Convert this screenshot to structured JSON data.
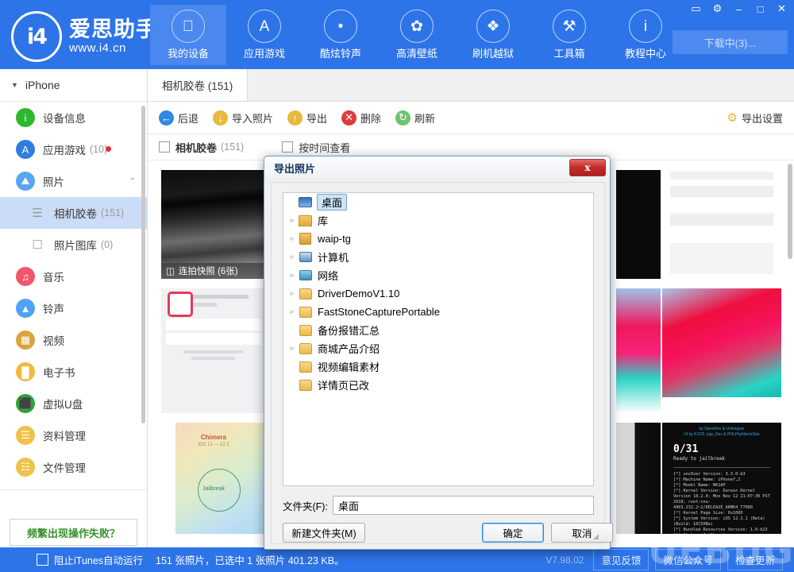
{
  "app": {
    "brand_cn": "爱思助手",
    "brand_url": "www.i4.cn",
    "logo_text": "i4",
    "accent": "#2d74e8",
    "accent_active": "#4a87ee"
  },
  "topnav": {
    "items": [
      {
        "label": "我的设备",
        "icon": "apple-icon",
        "glyph": "",
        "active": true
      },
      {
        "label": "应用游戏",
        "icon": "appstore-icon",
        "glyph": "A",
        "active": false
      },
      {
        "label": "酷炫铃声",
        "icon": "bell-icon",
        "glyph": "•",
        "active": false
      },
      {
        "label": "高清壁纸",
        "icon": "flower-icon",
        "glyph": "✿",
        "active": false
      },
      {
        "label": "刷机越狱",
        "icon": "box-icon",
        "glyph": "❖",
        "active": false
      },
      {
        "label": "工具箱",
        "icon": "tools-icon",
        "glyph": "⚒",
        "active": false
      },
      {
        "label": "教程中心",
        "icon": "info-icon",
        "glyph": "i",
        "active": false
      }
    ],
    "window_buttons": [
      {
        "name": "skin-icon",
        "glyph": "▭"
      },
      {
        "name": "settings-gear-icon",
        "glyph": "⚙"
      },
      {
        "name": "minimize-icon",
        "glyph": "–"
      },
      {
        "name": "maximize-icon",
        "glyph": "□"
      },
      {
        "name": "close-icon",
        "glyph": "✕"
      }
    ],
    "download_button": "下载中(3)..."
  },
  "sidebar": {
    "device_name": "iPhone",
    "items": [
      {
        "label": "设备信息",
        "icon": "info-circle-icon",
        "glyph": "i",
        "color": "#2eb82e",
        "count": "",
        "sub": false,
        "selected": false
      },
      {
        "label": "应用游戏",
        "icon": "appstore-circle-icon",
        "glyph": "A",
        "color": "#2f7de1",
        "count": "(10)",
        "badge": true,
        "sub": false,
        "selected": false
      },
      {
        "label": "照片",
        "icon": "photo-icon",
        "glyph": "⛰",
        "color": "#58a6f0",
        "count": "",
        "sub": false,
        "selected": false,
        "chevron": "⌃"
      },
      {
        "label": "相机胶卷",
        "icon": "camera-roll-icon",
        "glyph": "☰",
        "color": "",
        "count": "(151)",
        "sub": true,
        "selected": true
      },
      {
        "label": "照片图库",
        "icon": "folder-outline-icon",
        "glyph": "☐",
        "color": "",
        "count": "(0)",
        "sub": true,
        "selected": false
      },
      {
        "label": "音乐",
        "icon": "music-icon",
        "glyph": "♫",
        "color": "#f2566e",
        "count": "",
        "sub": false,
        "selected": false
      },
      {
        "label": "铃声",
        "icon": "ringtone-bell-icon",
        "glyph": "▲",
        "color": "#4fa3f7",
        "count": "",
        "sub": false,
        "selected": false
      },
      {
        "label": "视频",
        "icon": "video-film-icon",
        "glyph": "▦",
        "color": "#d9a441",
        "count": "",
        "sub": false,
        "selected": false
      },
      {
        "label": "电子书",
        "icon": "book-icon",
        "glyph": "█",
        "color": "#f3b93c",
        "count": "",
        "sub": false,
        "selected": false
      },
      {
        "label": "虚拟U盘",
        "icon": "usb-drive-icon",
        "glyph": "⬛",
        "color": "#2fa33a",
        "count": "",
        "sub": false,
        "selected": false
      },
      {
        "label": "资料管理",
        "icon": "data-manage-icon",
        "glyph": "☰",
        "color": "#f0c24b",
        "count": "",
        "sub": false,
        "selected": false
      },
      {
        "label": "文件管理",
        "icon": "file-manage-icon",
        "glyph": "☷",
        "color": "#f0c24b",
        "count": "",
        "sub": false,
        "selected": false
      }
    ],
    "help_button": "频繁出现操作失败？"
  },
  "content": {
    "tab_label": "相机胶卷 (151)",
    "toolbar": [
      {
        "label": "后退",
        "icon": "back-arrow-icon",
        "glyph": "←",
        "color": "#2f8ae0"
      },
      {
        "label": "导入照片",
        "icon": "import-photo-icon",
        "glyph": "↓",
        "color": "#e8b93c"
      },
      {
        "label": "导出",
        "icon": "export-icon",
        "glyph": "↑",
        "color": "#e8b93c"
      },
      {
        "label": "删除",
        "icon": "delete-icon",
        "glyph": "✕",
        "color": "#e03b3b"
      },
      {
        "label": "刷新",
        "icon": "refresh-icon",
        "glyph": "↻",
        "color": "#6ec46e"
      }
    ],
    "export_settings": "导出设置",
    "export_settings_icon": "gear-icon",
    "filter": {
      "album_label": "相机胶卷",
      "album_count": "(151)",
      "by_time_label": "按时间查看"
    },
    "thumbnails": [
      {
        "name": "burst-photo",
        "label": "连拍快照 (6张)",
        "icon": "stack-icon"
      },
      {
        "name": "screenshot-cydia"
      },
      {
        "name": "screenshot-log"
      },
      {
        "name": "screenshot-install"
      },
      {
        "name": "screenshot-chimera"
      },
      {
        "name": "screenshot-wallpaper-left"
      },
      {
        "name": "screenshot-wallpaper-right"
      },
      {
        "name": "screenshot-terminal-left"
      },
      {
        "name": "screenshot-unc0ver"
      }
    ]
  },
  "dialog": {
    "title": "导出照片",
    "close_icon": "close-x-icon",
    "tree": [
      {
        "label": "桌面",
        "icon": "desktop-icon",
        "glyph": "Ὓ5",
        "indent": 0,
        "expandable": false,
        "selected": true
      },
      {
        "label": "库",
        "icon": "library-icon",
        "indent": 0,
        "expandable": true,
        "selected": false
      },
      {
        "label": "waip-tg",
        "icon": "user-folder-icon",
        "indent": 0,
        "expandable": true,
        "selected": false
      },
      {
        "label": "计算机",
        "icon": "computer-icon",
        "indent": 0,
        "expandable": true,
        "selected": false
      },
      {
        "label": "网络",
        "icon": "network-icon",
        "indent": 0,
        "expandable": true,
        "selected": false
      },
      {
        "label": "DriverDemoV1.10",
        "icon": "folder-icon",
        "indent": 0,
        "expandable": true,
        "selected": false
      },
      {
        "label": "FastStoneCapturePortable",
        "icon": "folder-icon",
        "indent": 0,
        "expandable": true,
        "selected": false
      },
      {
        "label": "备份报错汇总",
        "icon": "folder-icon",
        "indent": 0,
        "expandable": false,
        "selected": false
      },
      {
        "label": "商城产品介绍",
        "icon": "folder-icon",
        "indent": 0,
        "expandable": true,
        "selected": false
      },
      {
        "label": "视频编辑素材",
        "icon": "folder-icon",
        "indent": 0,
        "expandable": false,
        "selected": false
      },
      {
        "label": "详情页已改",
        "icon": "folder-icon",
        "indent": 0,
        "expandable": false,
        "selected": false
      }
    ],
    "folder_label": "文件夹(F):",
    "folder_value": "桌面",
    "new_folder_button": "新建文件夹(M)",
    "ok_button": "确定",
    "cancel_button": "取消"
  },
  "statusbar": {
    "itunes_checkbox_label": "阻止iTunes自动运行",
    "status_text": "151 张照片，已选中 1 张照片 401.23 KB。",
    "version": "V7.98.02",
    "buttons": [
      "意见反馈",
      "微信公众号",
      "检查更新"
    ],
    "watermark": "UEBUG"
  }
}
